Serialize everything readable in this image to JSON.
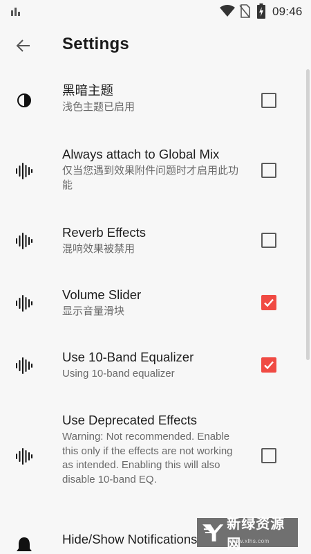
{
  "status_bar": {
    "time": "09:46"
  },
  "app_bar": {
    "title": "Settings"
  },
  "settings": [
    {
      "icon": "contrast-icon",
      "title": "黑暗主题",
      "subtitle": "浅色主题已启用",
      "checked": false
    },
    {
      "icon": "waveform-icon",
      "title": "Always attach to Global Mix",
      "subtitle": "仅当您遇到效果附件问题时才启用此功能",
      "checked": false
    },
    {
      "icon": "waveform-icon",
      "title": "Reverb Effects",
      "subtitle": "混响效果被禁用",
      "checked": false
    },
    {
      "icon": "waveform-icon",
      "title": "Volume Slider",
      "subtitle": "显示音量滑块",
      "checked": true
    },
    {
      "icon": "waveform-icon",
      "title": "Use 10-Band Equalizer",
      "subtitle": "Using 10-band equalizer",
      "checked": true
    },
    {
      "icon": "waveform-icon",
      "title": "Use Deprecated Effects",
      "subtitle": "Warning: Not recommended. Enable this only if the effects are not working as intended. Enabling this will also disable 10-band EQ.",
      "checked": false
    },
    {
      "icon": "bell-icon",
      "title": "Hide/Show Notifications",
      "subtitle": "",
      "checked": null
    }
  ],
  "watermark": {
    "text": "新绿资源网",
    "sub": "www.xlhs.com"
  },
  "colors": {
    "accent": "#f04a43",
    "background": "#f7f7f7"
  }
}
